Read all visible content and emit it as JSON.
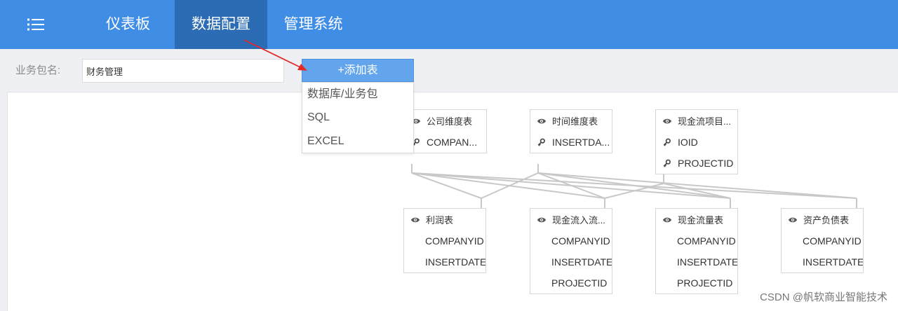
{
  "nav": {
    "menu_icon": "list-icon",
    "tabs": [
      {
        "label": "仪表板",
        "active": false
      },
      {
        "label": "数据配置",
        "active": true
      },
      {
        "label": "管理系统",
        "active": false
      }
    ]
  },
  "toolbar": {
    "package_label": "业务包名:",
    "package_value": "财务管理",
    "add_table_label": "+添加表",
    "add_table_menu": [
      "数据库/业务包",
      "SQL",
      "EXCEL"
    ]
  },
  "tables": [
    {
      "name": "公司维度表",
      "icon": "eye-icon",
      "fields": [
        {
          "name": "COMPAN...",
          "icon": "key-icon"
        }
      ]
    },
    {
      "name": "时间维度表",
      "icon": "eye-icon",
      "fields": [
        {
          "name": "INSERTDA...",
          "icon": "key-icon"
        }
      ]
    },
    {
      "name": "现金流项目...",
      "icon": "eye-icon",
      "fields": [
        {
          "name": "IOID",
          "icon": "key-icon"
        },
        {
          "name": "PROJECTID",
          "icon": "key-icon"
        }
      ]
    },
    {
      "name": "利润表",
      "icon": "eye-icon",
      "fields": [
        {
          "name": "COMPANYID"
        },
        {
          "name": "INSERTDATE"
        }
      ]
    },
    {
      "name": "现金流入流...",
      "icon": "eye-icon",
      "fields": [
        {
          "name": "COMPANYID"
        },
        {
          "name": "INSERTDATE"
        },
        {
          "name": "PROJECTID"
        }
      ]
    },
    {
      "name": "现金流量表",
      "icon": "eye-icon",
      "fields": [
        {
          "name": "COMPANYID"
        },
        {
          "name": "INSERTDATE"
        },
        {
          "name": "PROJECTID"
        }
      ]
    },
    {
      "name": "资产负债表",
      "icon": "eye-icon",
      "fields": [
        {
          "name": "COMPANYID"
        },
        {
          "name": "INSERTDATE"
        }
      ]
    }
  ],
  "colors": {
    "nav_bg": "#3f8de5",
    "nav_active_bg": "#2c6cb5",
    "button_bg": "#63a5ed",
    "relation_line": "#c8c8c8",
    "annotation_arrow": "#e22a2a"
  },
  "watermark": "CSDN @帆软商业智能技术"
}
